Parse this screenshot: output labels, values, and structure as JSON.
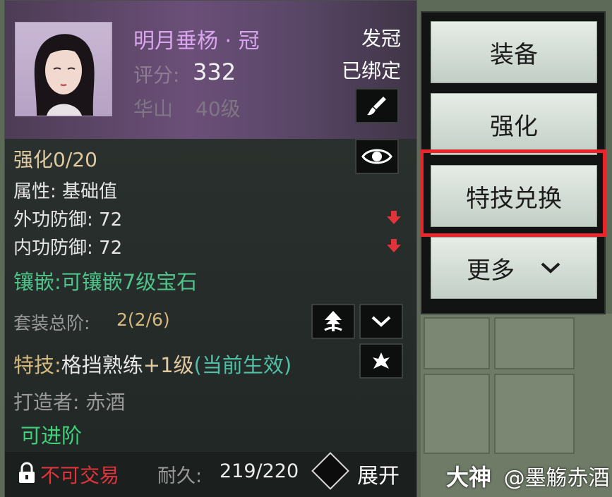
{
  "item": {
    "name": "明月垂杨 · 冠",
    "score_label": "评分:",
    "score_value": "332",
    "sect": "华山",
    "level": "40级",
    "slot": "发冠",
    "bound": "已绑定"
  },
  "stats": {
    "enhance": "强化0/20",
    "attr_label": "属性: 基础值",
    "outer_defense": "外功防御: 72",
    "inner_defense": "内功防御: 72",
    "inlay": "镶嵌:可镶嵌7级宝石",
    "set_label": "套装总阶:",
    "set_value": "2(2/6)",
    "skill_prefix": "特技:",
    "skill_name": "格挡熟练",
    "skill_level": "+1级",
    "skill_status": "(当前生效)",
    "crafter": "打造者: 赤酒",
    "advance": "可进阶"
  },
  "footer": {
    "trade": "不可交易",
    "durability_label": "耐久:",
    "durability_value": "219/220",
    "expand": "展开"
  },
  "menu": {
    "equip": "装备",
    "enhance": "强化",
    "skill_exchange": "特技兑换",
    "more": "更多"
  },
  "watermark": {
    "logo": "大神",
    "user": "@墨觞赤酒"
  },
  "colors": {
    "name": "#d9a6ee",
    "enhance": "#e0c9a0",
    "inlay": "#4fc48a",
    "skill_level": "#e0c9a0",
    "skill_status": "#4fc0a6",
    "advance": "#3fd17a",
    "untradeable": "#e2333a",
    "highlight": "#e8262c"
  }
}
